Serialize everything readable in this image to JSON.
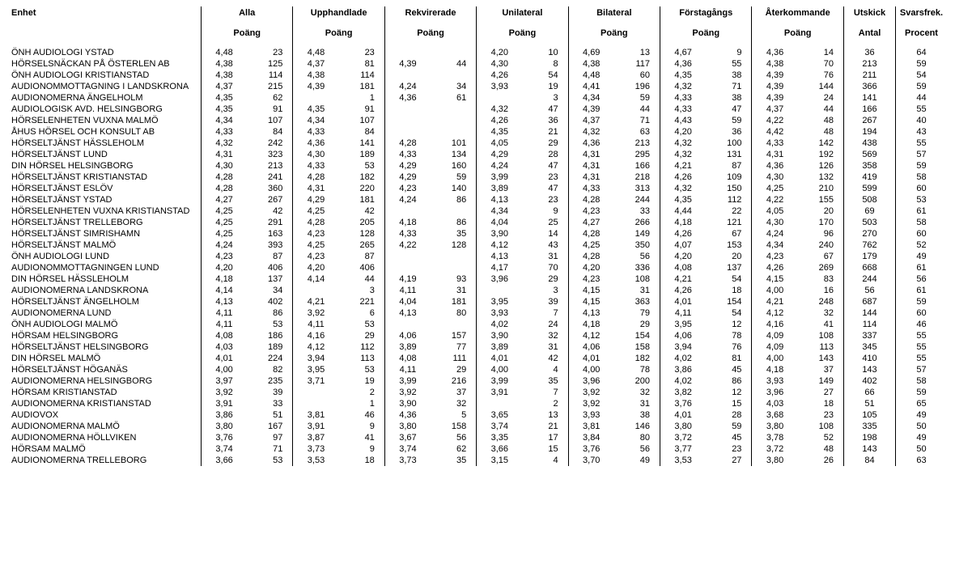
{
  "headers": {
    "unit": "Enhet",
    "groups": [
      "Alla",
      "Upphandlade",
      "Rekvirerade",
      "Unilateral",
      "Bilateral",
      "Förstagångs",
      "Återkommande"
    ],
    "sub_score": "Poäng",
    "utskick": "Utskick",
    "svarsfrek": "Svarsfrek.",
    "antal": "Antal",
    "procent": "Procent"
  },
  "rows": [
    {
      "unit": "ÖNH AUDIOLOGI YSTAD",
      "alla": [
        "4,48",
        "23"
      ],
      "upp": [
        "4,48",
        "23"
      ],
      "rek": [
        "",
        ""
      ],
      "uni": [
        "4,20",
        "10"
      ],
      "bil": [
        "4,69",
        "13"
      ],
      "for": [
        "4,67",
        "9"
      ],
      "ate": [
        "4,36",
        "14"
      ],
      "ut": "36",
      "sv": "64"
    },
    {
      "unit": "HÖRSELSNÄCKAN PÅ ÖSTERLEN AB",
      "alla": [
        "4,38",
        "125"
      ],
      "upp": [
        "4,37",
        "81"
      ],
      "rek": [
        "4,39",
        "44"
      ],
      "uni": [
        "4,30",
        "8"
      ],
      "bil": [
        "4,38",
        "117"
      ],
      "for": [
        "4,36",
        "55"
      ],
      "ate": [
        "4,38",
        "70"
      ],
      "ut": "213",
      "sv": "59"
    },
    {
      "unit": "ÖNH AUDIOLOGI KRISTIANSTAD",
      "alla": [
        "4,38",
        "114"
      ],
      "upp": [
        "4,38",
        "114"
      ],
      "rek": [
        "",
        ""
      ],
      "uni": [
        "4,26",
        "54"
      ],
      "bil": [
        "4,48",
        "60"
      ],
      "for": [
        "4,35",
        "38"
      ],
      "ate": [
        "4,39",
        "76"
      ],
      "ut": "211",
      "sv": "54"
    },
    {
      "unit": "AUDIONOMMOTTAGNING I LANDSKRONA",
      "alla": [
        "4,37",
        "215"
      ],
      "upp": [
        "4,39",
        "181"
      ],
      "rek": [
        "4,24",
        "34"
      ],
      "uni": [
        "3,93",
        "19"
      ],
      "bil": [
        "4,41",
        "196"
      ],
      "for": [
        "4,32",
        "71"
      ],
      "ate": [
        "4,39",
        "144"
      ],
      "ut": "366",
      "sv": "59"
    },
    {
      "unit": "AUDIONOMERNA ÄNGELHOLM",
      "alla": [
        "4,35",
        "62"
      ],
      "upp": [
        "",
        "1"
      ],
      "rek": [
        "4,36",
        "61"
      ],
      "uni": [
        "",
        "3"
      ],
      "bil": [
        "4,34",
        "59"
      ],
      "for": [
        "4,33",
        "38"
      ],
      "ate": [
        "4,39",
        "24"
      ],
      "ut": "141",
      "sv": "44"
    },
    {
      "unit": "AUDIOLOGISK AVD. HELSINGBORG",
      "alla": [
        "4,35",
        "91"
      ],
      "upp": [
        "4,35",
        "91"
      ],
      "rek": [
        "",
        ""
      ],
      "uni": [
        "4,32",
        "47"
      ],
      "bil": [
        "4,39",
        "44"
      ],
      "for": [
        "4,33",
        "47"
      ],
      "ate": [
        "4,37",
        "44"
      ],
      "ut": "166",
      "sv": "55"
    },
    {
      "unit": "HÖRSELENHETEN VUXNA MALMÖ",
      "alla": [
        "4,34",
        "107"
      ],
      "upp": [
        "4,34",
        "107"
      ],
      "rek": [
        "",
        ""
      ],
      "uni": [
        "4,26",
        "36"
      ],
      "bil": [
        "4,37",
        "71"
      ],
      "for": [
        "4,43",
        "59"
      ],
      "ate": [
        "4,22",
        "48"
      ],
      "ut": "267",
      "sv": "40"
    },
    {
      "unit": "ÅHUS HÖRSEL OCH KONSULT AB",
      "alla": [
        "4,33",
        "84"
      ],
      "upp": [
        "4,33",
        "84"
      ],
      "rek": [
        "",
        ""
      ],
      "uni": [
        "4,35",
        "21"
      ],
      "bil": [
        "4,32",
        "63"
      ],
      "for": [
        "4,20",
        "36"
      ],
      "ate": [
        "4,42",
        "48"
      ],
      "ut": "194",
      "sv": "43"
    },
    {
      "unit": "HÖRSELTJÄNST HÄSSLEHOLM",
      "alla": [
        "4,32",
        "242"
      ],
      "upp": [
        "4,36",
        "141"
      ],
      "rek": [
        "4,28",
        "101"
      ],
      "uni": [
        "4,05",
        "29"
      ],
      "bil": [
        "4,36",
        "213"
      ],
      "for": [
        "4,32",
        "100"
      ],
      "ate": [
        "4,33",
        "142"
      ],
      "ut": "438",
      "sv": "55"
    },
    {
      "unit": "HÖRSELTJÄNST LUND",
      "alla": [
        "4,31",
        "323"
      ],
      "upp": [
        "4,30",
        "189"
      ],
      "rek": [
        "4,33",
        "134"
      ],
      "uni": [
        "4,29",
        "28"
      ],
      "bil": [
        "4,31",
        "295"
      ],
      "for": [
        "4,32",
        "131"
      ],
      "ate": [
        "4,31",
        "192"
      ],
      "ut": "569",
      "sv": "57"
    },
    {
      "unit": "DIN HÖRSEL HELSINGBORG",
      "alla": [
        "4,30",
        "213"
      ],
      "upp": [
        "4,33",
        "53"
      ],
      "rek": [
        "4,29",
        "160"
      ],
      "uni": [
        "4,24",
        "47"
      ],
      "bil": [
        "4,31",
        "166"
      ],
      "for": [
        "4,21",
        "87"
      ],
      "ate": [
        "4,36",
        "126"
      ],
      "ut": "358",
      "sv": "59"
    },
    {
      "unit": "HÖRSELTJÄNST KRISTIANSTAD",
      "alla": [
        "4,28",
        "241"
      ],
      "upp": [
        "4,28",
        "182"
      ],
      "rek": [
        "4,29",
        "59"
      ],
      "uni": [
        "3,99",
        "23"
      ],
      "bil": [
        "4,31",
        "218"
      ],
      "for": [
        "4,26",
        "109"
      ],
      "ate": [
        "4,30",
        "132"
      ],
      "ut": "419",
      "sv": "58"
    },
    {
      "unit": "HÖRSELTJÄNST ESLÖV",
      "alla": [
        "4,28",
        "360"
      ],
      "upp": [
        "4,31",
        "220"
      ],
      "rek": [
        "4,23",
        "140"
      ],
      "uni": [
        "3,89",
        "47"
      ],
      "bil": [
        "4,33",
        "313"
      ],
      "for": [
        "4,32",
        "150"
      ],
      "ate": [
        "4,25",
        "210"
      ],
      "ut": "599",
      "sv": "60"
    },
    {
      "unit": "HÖRSELTJÄNST YSTAD",
      "alla": [
        "4,27",
        "267"
      ],
      "upp": [
        "4,29",
        "181"
      ],
      "rek": [
        "4,24",
        "86"
      ],
      "uni": [
        "4,13",
        "23"
      ],
      "bil": [
        "4,28",
        "244"
      ],
      "for": [
        "4,35",
        "112"
      ],
      "ate": [
        "4,22",
        "155"
      ],
      "ut": "508",
      "sv": "53"
    },
    {
      "unit": "HÖRSELENHETEN VUXNA KRISTIANSTAD",
      "alla": [
        "4,25",
        "42"
      ],
      "upp": [
        "4,25",
        "42"
      ],
      "rek": [
        "",
        ""
      ],
      "uni": [
        "4,34",
        "9"
      ],
      "bil": [
        "4,23",
        "33"
      ],
      "for": [
        "4,44",
        "22"
      ],
      "ate": [
        "4,05",
        "20"
      ],
      "ut": "69",
      "sv": "61"
    },
    {
      "unit": "HÖRSELTJÄNST TRELLEBORG",
      "alla": [
        "4,25",
        "291"
      ],
      "upp": [
        "4,28",
        "205"
      ],
      "rek": [
        "4,18",
        "86"
      ],
      "uni": [
        "4,04",
        "25"
      ],
      "bil": [
        "4,27",
        "266"
      ],
      "for": [
        "4,18",
        "121"
      ],
      "ate": [
        "4,30",
        "170"
      ],
      "ut": "503",
      "sv": "58"
    },
    {
      "unit": "HÖRSELTJÄNST SIMRISHAMN",
      "alla": [
        "4,25",
        "163"
      ],
      "upp": [
        "4,23",
        "128"
      ],
      "rek": [
        "4,33",
        "35"
      ],
      "uni": [
        "3,90",
        "14"
      ],
      "bil": [
        "4,28",
        "149"
      ],
      "for": [
        "4,26",
        "67"
      ],
      "ate": [
        "4,24",
        "96"
      ],
      "ut": "270",
      "sv": "60"
    },
    {
      "unit": "HÖRSELTJÄNST MALMÖ",
      "alla": [
        "4,24",
        "393"
      ],
      "upp": [
        "4,25",
        "265"
      ],
      "rek": [
        "4,22",
        "128"
      ],
      "uni": [
        "4,12",
        "43"
      ],
      "bil": [
        "4,25",
        "350"
      ],
      "for": [
        "4,07",
        "153"
      ],
      "ate": [
        "4,34",
        "240"
      ],
      "ut": "762",
      "sv": "52"
    },
    {
      "unit": "ÖNH AUDIOLOGI LUND",
      "alla": [
        "4,23",
        "87"
      ],
      "upp": [
        "4,23",
        "87"
      ],
      "rek": [
        "",
        ""
      ],
      "uni": [
        "4,13",
        "31"
      ],
      "bil": [
        "4,28",
        "56"
      ],
      "for": [
        "4,20",
        "20"
      ],
      "ate": [
        "4,23",
        "67"
      ],
      "ut": "179",
      "sv": "49"
    },
    {
      "unit": "AUDIONOMMOTTAGNINGEN LUND",
      "alla": [
        "4,20",
        "406"
      ],
      "upp": [
        "4,20",
        "406"
      ],
      "rek": [
        "",
        ""
      ],
      "uni": [
        "4,17",
        "70"
      ],
      "bil": [
        "4,20",
        "336"
      ],
      "for": [
        "4,08",
        "137"
      ],
      "ate": [
        "4,26",
        "269"
      ],
      "ut": "668",
      "sv": "61"
    },
    {
      "unit": "DIN HÖRSEL HÄSSLEHOLM",
      "alla": [
        "4,18",
        "137"
      ],
      "upp": [
        "4,14",
        "44"
      ],
      "rek": [
        "4,19",
        "93"
      ],
      "uni": [
        "3,96",
        "29"
      ],
      "bil": [
        "4,23",
        "108"
      ],
      "for": [
        "4,21",
        "54"
      ],
      "ate": [
        "4,15",
        "83"
      ],
      "ut": "244",
      "sv": "56"
    },
    {
      "unit": "AUDIONOMERNA LANDSKRONA",
      "alla": [
        "4,14",
        "34"
      ],
      "upp": [
        "",
        "3"
      ],
      "rek": [
        "4,11",
        "31"
      ],
      "uni": [
        "",
        "3"
      ],
      "bil": [
        "4,15",
        "31"
      ],
      "for": [
        "4,26",
        "18"
      ],
      "ate": [
        "4,00",
        "16"
      ],
      "ut": "56",
      "sv": "61"
    },
    {
      "unit": "HÖRSELTJÄNST ÄNGELHOLM",
      "alla": [
        "4,13",
        "402"
      ],
      "upp": [
        "4,21",
        "221"
      ],
      "rek": [
        "4,04",
        "181"
      ],
      "uni": [
        "3,95",
        "39"
      ],
      "bil": [
        "4,15",
        "363"
      ],
      "for": [
        "4,01",
        "154"
      ],
      "ate": [
        "4,21",
        "248"
      ],
      "ut": "687",
      "sv": "59"
    },
    {
      "unit": "AUDIONOMERNA LUND",
      "alla": [
        "4,11",
        "86"
      ],
      "upp": [
        "3,92",
        "6"
      ],
      "rek": [
        "4,13",
        "80"
      ],
      "uni": [
        "3,93",
        "7"
      ],
      "bil": [
        "4,13",
        "79"
      ],
      "for": [
        "4,11",
        "54"
      ],
      "ate": [
        "4,12",
        "32"
      ],
      "ut": "144",
      "sv": "60"
    },
    {
      "unit": "ÖNH AUDIOLOGI MALMÖ",
      "alla": [
        "4,11",
        "53"
      ],
      "upp": [
        "4,11",
        "53"
      ],
      "rek": [
        "",
        ""
      ],
      "uni": [
        "4,02",
        "24"
      ],
      "bil": [
        "4,18",
        "29"
      ],
      "for": [
        "3,95",
        "12"
      ],
      "ate": [
        "4,16",
        "41"
      ],
      "ut": "114",
      "sv": "46"
    },
    {
      "unit": "HÖRSAM HELSINGBORG",
      "alla": [
        "4,08",
        "186"
      ],
      "upp": [
        "4,16",
        "29"
      ],
      "rek": [
        "4,06",
        "157"
      ],
      "uni": [
        "3,90",
        "32"
      ],
      "bil": [
        "4,12",
        "154"
      ],
      "for": [
        "4,06",
        "78"
      ],
      "ate": [
        "4,09",
        "108"
      ],
      "ut": "337",
      "sv": "55"
    },
    {
      "unit": "HÖRSELTJÄNST HELSINGBORG",
      "alla": [
        "4,03",
        "189"
      ],
      "upp": [
        "4,12",
        "112"
      ],
      "rek": [
        "3,89",
        "77"
      ],
      "uni": [
        "3,89",
        "31"
      ],
      "bil": [
        "4,06",
        "158"
      ],
      "for": [
        "3,94",
        "76"
      ],
      "ate": [
        "4,09",
        "113"
      ],
      "ut": "345",
      "sv": "55"
    },
    {
      "unit": "DIN HÖRSEL MALMÖ",
      "alla": [
        "4,01",
        "224"
      ],
      "upp": [
        "3,94",
        "113"
      ],
      "rek": [
        "4,08",
        "111"
      ],
      "uni": [
        "4,01",
        "42"
      ],
      "bil": [
        "4,01",
        "182"
      ],
      "for": [
        "4,02",
        "81"
      ],
      "ate": [
        "4,00",
        "143"
      ],
      "ut": "410",
      "sv": "55"
    },
    {
      "unit": "HÖRSELTJÄNST HÖGANÄS",
      "alla": [
        "4,00",
        "82"
      ],
      "upp": [
        "3,95",
        "53"
      ],
      "rek": [
        "4,11",
        "29"
      ],
      "uni": [
        "4,00",
        "4"
      ],
      "bil": [
        "4,00",
        "78"
      ],
      "for": [
        "3,86",
        "45"
      ],
      "ate": [
        "4,18",
        "37"
      ],
      "ut": "143",
      "sv": "57"
    },
    {
      "unit": "AUDIONOMERNA HELSINGBORG",
      "alla": [
        "3,97",
        "235"
      ],
      "upp": [
        "3,71",
        "19"
      ],
      "rek": [
        "3,99",
        "216"
      ],
      "uni": [
        "3,99",
        "35"
      ],
      "bil": [
        "3,96",
        "200"
      ],
      "for": [
        "4,02",
        "86"
      ],
      "ate": [
        "3,93",
        "149"
      ],
      "ut": "402",
      "sv": "58"
    },
    {
      "unit": "HÖRSAM KRISTIANSTAD",
      "alla": [
        "3,92",
        "39"
      ],
      "upp": [
        "",
        "2"
      ],
      "rek": [
        "3,92",
        "37"
      ],
      "uni": [
        "3,91",
        "7"
      ],
      "bil": [
        "3,92",
        "32"
      ],
      "for": [
        "3,82",
        "12"
      ],
      "ate": [
        "3,96",
        "27"
      ],
      "ut": "66",
      "sv": "59"
    },
    {
      "unit": "AUDIONOMERNA KRISTIANSTAD",
      "alla": [
        "3,91",
        "33"
      ],
      "upp": [
        "",
        "1"
      ],
      "rek": [
        "3,90",
        "32"
      ],
      "uni": [
        "",
        "2"
      ],
      "bil": [
        "3,92",
        "31"
      ],
      "for": [
        "3,76",
        "15"
      ],
      "ate": [
        "4,03",
        "18"
      ],
      "ut": "51",
      "sv": "65"
    },
    {
      "unit": "AUDIOVOX",
      "alla": [
        "3,86",
        "51"
      ],
      "upp": [
        "3,81",
        "46"
      ],
      "rek": [
        "4,36",
        "5"
      ],
      "uni": [
        "3,65",
        "13"
      ],
      "bil": [
        "3,93",
        "38"
      ],
      "for": [
        "4,01",
        "28"
      ],
      "ate": [
        "3,68",
        "23"
      ],
      "ut": "105",
      "sv": "49"
    },
    {
      "unit": "AUDIONOMERNA MALMÖ",
      "alla": [
        "3,80",
        "167"
      ],
      "upp": [
        "3,91",
        "9"
      ],
      "rek": [
        "3,80",
        "158"
      ],
      "uni": [
        "3,74",
        "21"
      ],
      "bil": [
        "3,81",
        "146"
      ],
      "for": [
        "3,80",
        "59"
      ],
      "ate": [
        "3,80",
        "108"
      ],
      "ut": "335",
      "sv": "50"
    },
    {
      "unit": "AUDIONOMERNA HÖLLVIKEN",
      "alla": [
        "3,76",
        "97"
      ],
      "upp": [
        "3,87",
        "41"
      ],
      "rek": [
        "3,67",
        "56"
      ],
      "uni": [
        "3,35",
        "17"
      ],
      "bil": [
        "3,84",
        "80"
      ],
      "for": [
        "3,72",
        "45"
      ],
      "ate": [
        "3,78",
        "52"
      ],
      "ut": "198",
      "sv": "49"
    },
    {
      "unit": "HÖRSAM MALMÖ",
      "alla": [
        "3,74",
        "71"
      ],
      "upp": [
        "3,73",
        "9"
      ],
      "rek": [
        "3,74",
        "62"
      ],
      "uni": [
        "3,66",
        "15"
      ],
      "bil": [
        "3,76",
        "56"
      ],
      "for": [
        "3,77",
        "23"
      ],
      "ate": [
        "3,72",
        "48"
      ],
      "ut": "143",
      "sv": "50"
    },
    {
      "unit": "AUDIONOMERNA TRELLEBORG",
      "alla": [
        "3,66",
        "53"
      ],
      "upp": [
        "3,53",
        "18"
      ],
      "rek": [
        "3,73",
        "35"
      ],
      "uni": [
        "3,15",
        "4"
      ],
      "bil": [
        "3,70",
        "49"
      ],
      "for": [
        "3,53",
        "27"
      ],
      "ate": [
        "3,80",
        "26"
      ],
      "ut": "84",
      "sv": "63"
    }
  ]
}
